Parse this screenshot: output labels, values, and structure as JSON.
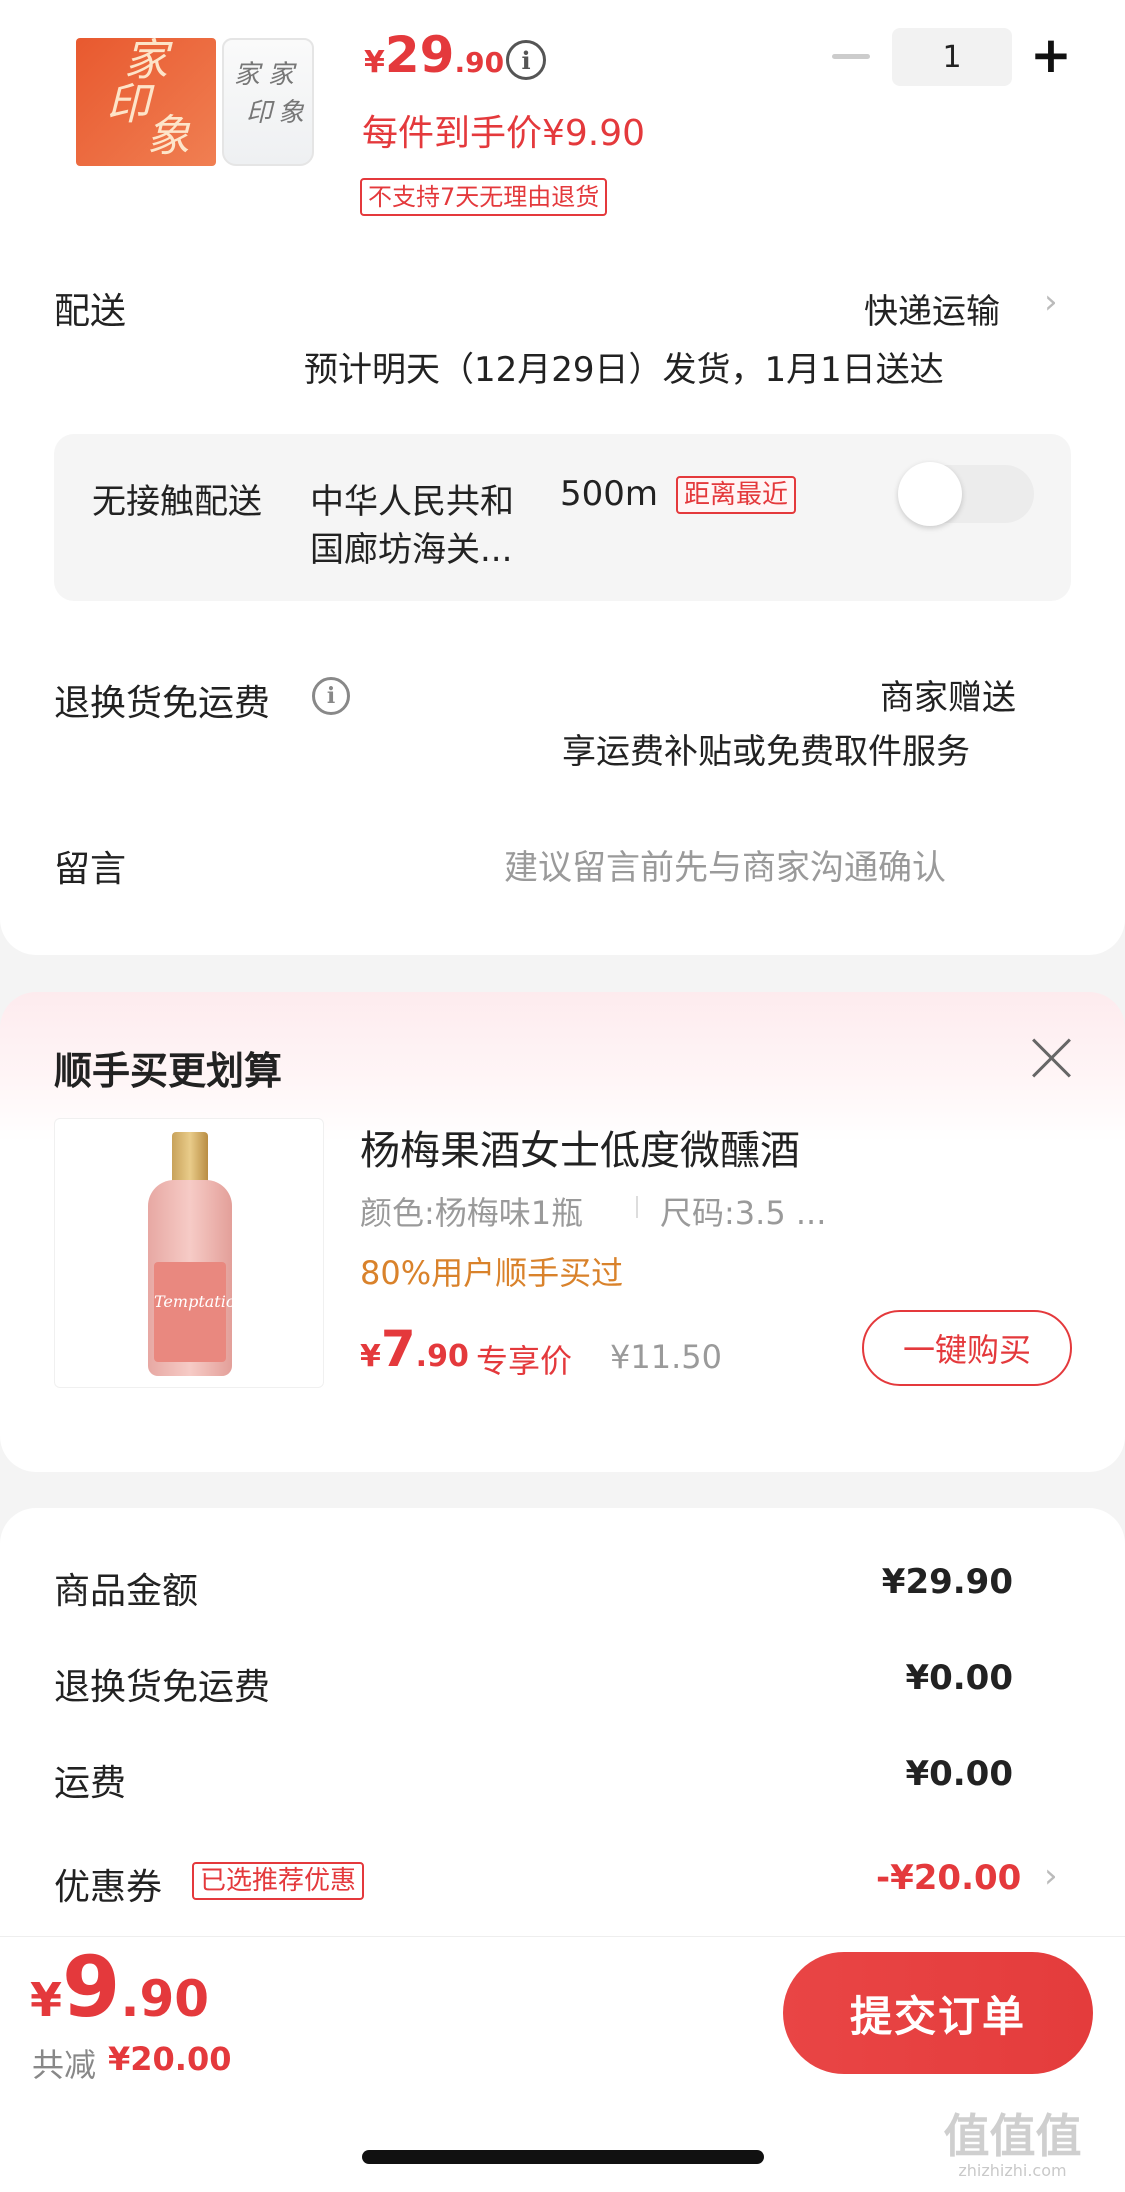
{
  "product": {
    "box_chars": [
      "家",
      "印",
      "象"
    ],
    "bottle_chars": [
      "家",
      "家",
      "印",
      "象"
    ],
    "price_symbol": "¥",
    "price_int": "29",
    "price_dec": ".90",
    "unit_price": "每件到手价¥9.90",
    "return_tag": "不支持7天无理由退货",
    "quantity": "1",
    "info_glyph": "i"
  },
  "delivery": {
    "label": "配送",
    "method": "快递运输",
    "estimate": "预计明天（12月29日）发货，1月1日送达",
    "chevron": "›"
  },
  "contactless": {
    "label": "无接触配送",
    "address_line1": "中华人民共和",
    "distance": "500m",
    "nearest_tag": "距离最近",
    "address_line2": "国廊坊海关...",
    "toggle_on": false
  },
  "return_shipping": {
    "label": "退换货免运费",
    "info_glyph": "i",
    "gift": "商家赠送",
    "desc": "享运费补贴或免费取件服务"
  },
  "message": {
    "label": "留言",
    "placeholder": "建议留言前先与商家沟通确认"
  },
  "addon": {
    "title": "顺手买更划算",
    "product_name": "杨梅果酒女士低度微醺酒",
    "spec_color": "颜色:杨梅味1瓶",
    "spec_size": "尺码:3.5 ...",
    "social": "80%用户顺手买过",
    "price_symbol": "¥",
    "price_int": "7",
    "price_dec": ".90",
    "exclusive_label": "专享价",
    "original_price": "¥11.50",
    "buy_button": "一键购买",
    "bottle_label": "Temptation"
  },
  "summary": {
    "rows": [
      {
        "label": "商品金额",
        "value": "¥29.90"
      },
      {
        "label": "退换货免运费",
        "value": "¥0.00"
      },
      {
        "label": "运费",
        "value": "¥0.00"
      }
    ],
    "coupon_label": "优惠券",
    "coupon_tag": "已选推荐优惠",
    "coupon_value": "-¥20.00",
    "chevron": "›"
  },
  "footer": {
    "total_symbol": "¥",
    "total_int": "9",
    "total_dec": ".90",
    "saved_label": "共减",
    "saved_value": "¥20.00",
    "submit": "提交订单"
  },
  "watermark": {
    "text": "值值值",
    "domain": "zhizhizhi.com"
  },
  "colors": {
    "accent": "#e4393c",
    "orange_text": "#d9822b"
  }
}
